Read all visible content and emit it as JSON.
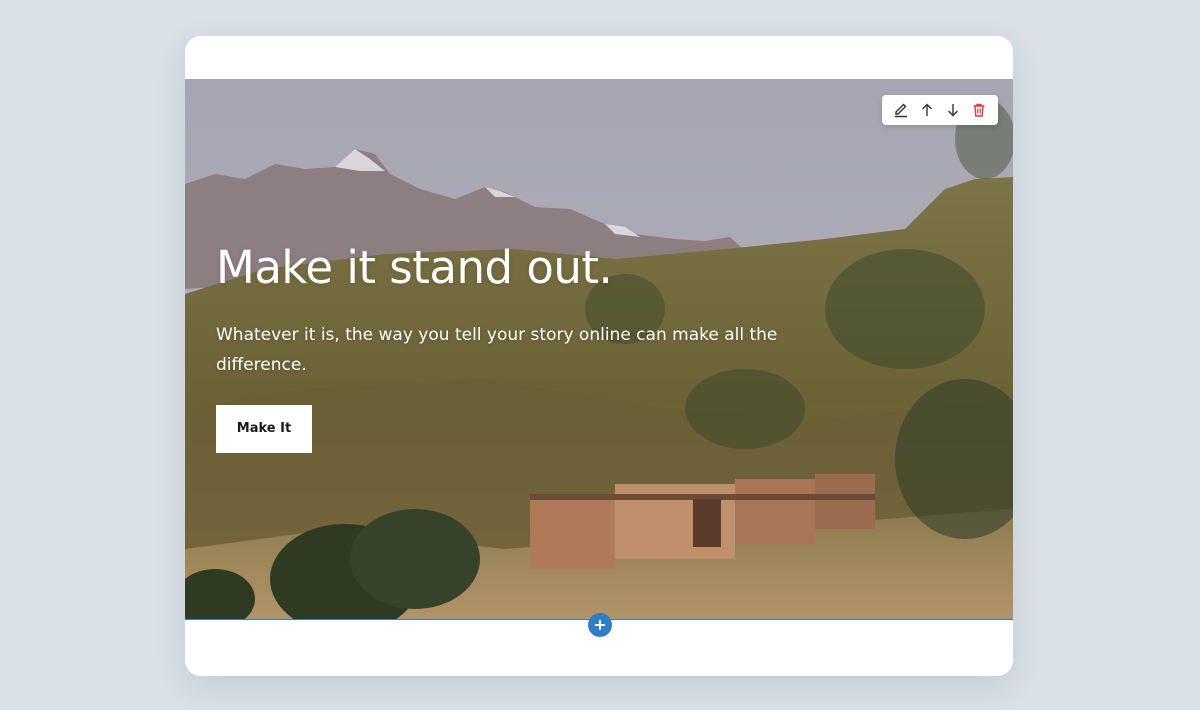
{
  "hero": {
    "title": "Make it stand out.",
    "subtitle": "Whatever it is, the way you tell your story online can make all the difference.",
    "cta_label": "Make It"
  },
  "toolbar": {
    "icons": [
      "edit-icon",
      "arrow-up-icon",
      "arrow-down-icon",
      "trash-icon"
    ]
  },
  "colors": {
    "page_background": "#d9e0e7",
    "accent": "#2e7fc4",
    "delete": "#e0383e"
  }
}
